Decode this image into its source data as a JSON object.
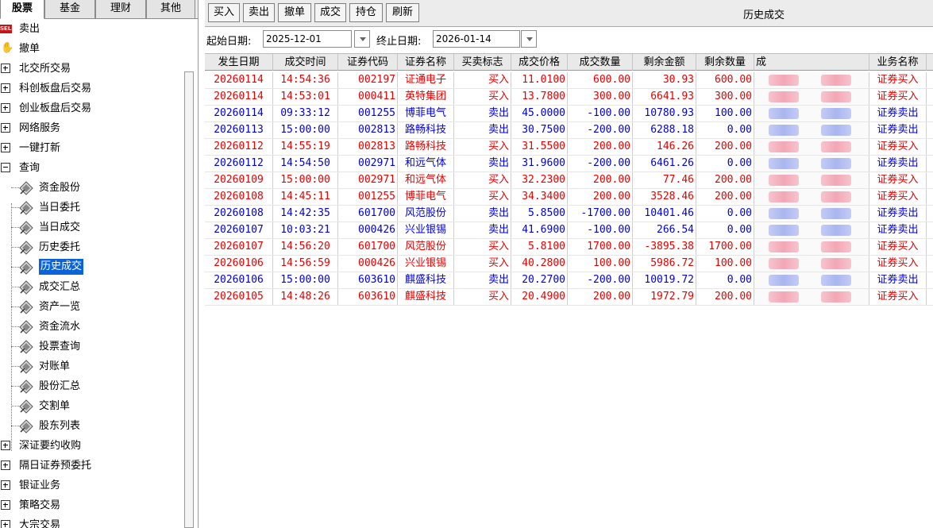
{
  "sidebar": {
    "tabs": [
      "股票",
      "基金",
      "理财",
      "其他"
    ],
    "tree": [
      {
        "label": "卖出",
        "icon": "sell-icon"
      },
      {
        "label": "撤单",
        "icon": "hand-icon"
      },
      {
        "label": "北交所交易",
        "icon": "expand-icon"
      },
      {
        "label": "科创板盘后交易",
        "icon": "expand-icon"
      },
      {
        "label": "创业板盘后交易",
        "icon": "expand-icon"
      },
      {
        "label": "网络服务",
        "icon": "expand-icon"
      },
      {
        "label": "一键打新",
        "icon": "expand-icon"
      },
      {
        "label": "查询",
        "icon": "collapse-icon"
      },
      {
        "label": "资金股份",
        "icon": "diamond-icon"
      },
      {
        "label": "当日委托",
        "icon": "diamond-icon"
      },
      {
        "label": "当日成交",
        "icon": "diamond-icon"
      },
      {
        "label": "历史委托",
        "icon": "diamond-icon"
      },
      {
        "label": "历史成交",
        "icon": "diamond-icon",
        "selected": true
      },
      {
        "label": "成交汇总",
        "icon": "diamond-icon"
      },
      {
        "label": "资产一览",
        "icon": "diamond-icon"
      },
      {
        "label": "资金流水",
        "icon": "diamond-icon"
      },
      {
        "label": "投票查询",
        "icon": "diamond-icon"
      },
      {
        "label": "对账单",
        "icon": "diamond-icon"
      },
      {
        "label": "股份汇总",
        "icon": "diamond-icon"
      },
      {
        "label": "交割单",
        "icon": "diamond-icon"
      },
      {
        "label": "股东列表",
        "icon": "diamond-icon"
      },
      {
        "label": "深证要约收购",
        "icon": "expand-icon"
      },
      {
        "label": "隔日证券预委托",
        "icon": "expand-icon"
      },
      {
        "label": "银证业务",
        "icon": "expand-icon"
      },
      {
        "label": "策略交易",
        "icon": "expand-icon"
      },
      {
        "label": "大宗交易",
        "icon": "expand-icon"
      }
    ]
  },
  "toolbar": {
    "buttons": [
      "买入",
      "卖出",
      "撤单",
      "成交",
      "持仓",
      "刷新"
    ],
    "title": "历史成交"
  },
  "filter": {
    "start_label": "起始日期:",
    "start_value": "2025-12-01",
    "end_label": "终止日期:",
    "end_value": "2026-01-14"
  },
  "table": {
    "columns": [
      "发生日期",
      "成交时间",
      "证券代码",
      "证券名称",
      "买卖标志",
      "成交价格",
      "成交数量",
      "剩余金额",
      "剩余数量",
      "成",
      "业务名称"
    ],
    "rows": [
      {
        "date": "20260114",
        "time": "14:54:36",
        "code": "002197",
        "name": "证通电子",
        "side": "买入",
        "price": "11.0100",
        "qty": "600.00",
        "amount": "30.93",
        "remain": "600.00",
        "biz": "证券买入"
      },
      {
        "date": "20260114",
        "time": "14:53:01",
        "code": "000411",
        "name": "英特集团",
        "side": "买入",
        "price": "13.7800",
        "qty": "300.00",
        "amount": "6641.93",
        "remain": "300.00",
        "biz": "证券买入"
      },
      {
        "date": "20260114",
        "time": "09:33:12",
        "code": "001255",
        "name": "博菲电气",
        "side": "卖出",
        "price": "45.0000",
        "qty": "-100.00",
        "amount": "10780.93",
        "remain": "100.00",
        "biz": "证券卖出"
      },
      {
        "date": "20260113",
        "time": "15:00:00",
        "code": "002813",
        "name": "路畅科技",
        "side": "卖出",
        "price": "30.7500",
        "qty": "-200.00",
        "amount": "6288.18",
        "remain": "0.00",
        "biz": "证券卖出"
      },
      {
        "date": "20260112",
        "time": "14:55:19",
        "code": "002813",
        "name": "路畅科技",
        "side": "买入",
        "price": "31.5500",
        "qty": "200.00",
        "amount": "146.26",
        "remain": "200.00",
        "biz": "证券买入"
      },
      {
        "date": "20260112",
        "time": "14:54:50",
        "code": "002971",
        "name": "和远气体",
        "side": "卖出",
        "price": "31.9600",
        "qty": "-200.00",
        "amount": "6461.26",
        "remain": "0.00",
        "biz": "证券卖出"
      },
      {
        "date": "20260109",
        "time": "15:00:00",
        "code": "002971",
        "name": "和远气体",
        "side": "买入",
        "price": "32.2300",
        "qty": "200.00",
        "amount": "77.46",
        "remain": "200.00",
        "biz": "证券买入"
      },
      {
        "date": "20260108",
        "time": "14:45:11",
        "code": "001255",
        "name": "博菲电气",
        "side": "买入",
        "price": "34.3400",
        "qty": "200.00",
        "amount": "3528.46",
        "remain": "200.00",
        "biz": "证券买入"
      },
      {
        "date": "20260108",
        "time": "14:42:35",
        "code": "601700",
        "name": "风范股份",
        "side": "卖出",
        "price": "5.8500",
        "qty": "-1700.00",
        "amount": "10401.46",
        "remain": "0.00",
        "biz": "证券卖出"
      },
      {
        "date": "20260107",
        "time": "10:03:21",
        "code": "000426",
        "name": "兴业银锡",
        "side": "卖出",
        "price": "41.6900",
        "qty": "-100.00",
        "amount": "266.54",
        "remain": "0.00",
        "biz": "证券卖出"
      },
      {
        "date": "20260107",
        "time": "14:56:20",
        "code": "601700",
        "name": "风范股份",
        "side": "买入",
        "price": "5.8100",
        "qty": "1700.00",
        "amount": "-3895.38",
        "remain": "1700.00",
        "biz": "证券买入"
      },
      {
        "date": "20260106",
        "time": "14:56:59",
        "code": "000426",
        "name": "兴业银锡",
        "side": "买入",
        "price": "40.2800",
        "qty": "100.00",
        "amount": "5986.72",
        "remain": "100.00",
        "biz": "证券买入"
      },
      {
        "date": "20260106",
        "time": "15:00:00",
        "code": "603610",
        "name": "麒盛科技",
        "side": "卖出",
        "price": "20.2700",
        "qty": "-200.00",
        "amount": "10019.72",
        "remain": "0.00",
        "biz": "证券卖出"
      },
      {
        "date": "20260105",
        "time": "14:48:26",
        "code": "603610",
        "name": "麒盛科技",
        "side": "买入",
        "price": "20.4900",
        "qty": "200.00",
        "amount": "1972.79",
        "remain": "200.00",
        "biz": "证券买入"
      }
    ]
  },
  "colors": {
    "buy": "#e60000",
    "sell": "#0000d8",
    "selected": "#0a64d8"
  }
}
